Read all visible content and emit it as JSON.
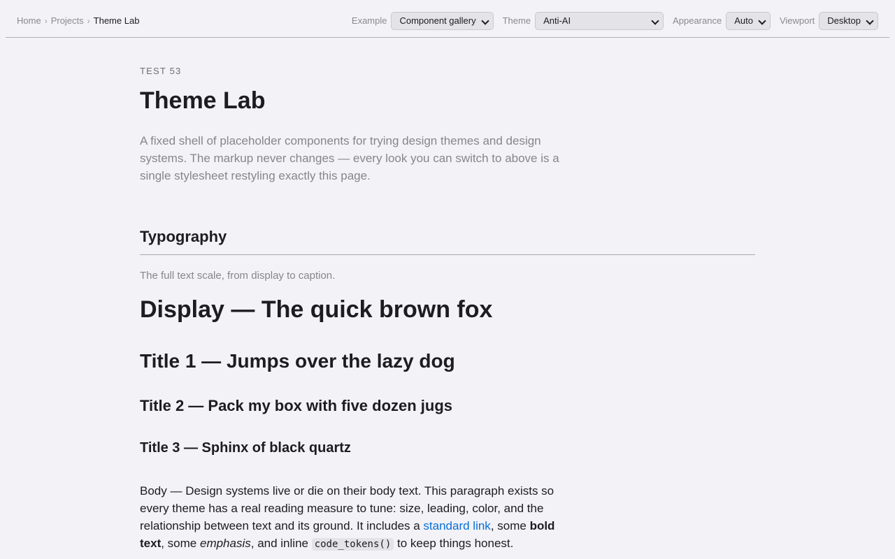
{
  "breadcrumb": {
    "items": [
      "Home",
      "Projects"
    ],
    "separator": "›",
    "current": "Theme Lab"
  },
  "controls": {
    "example": {
      "label": "Example",
      "value": "Component gallery"
    },
    "theme": {
      "label": "Theme",
      "value": "Anti-AI"
    },
    "appearance": {
      "label": "Appearance",
      "value": "Auto"
    },
    "viewport": {
      "label": "Viewport",
      "value": "Desktop"
    }
  },
  "page": {
    "eyebrow": "TEST 53",
    "title": "Theme Lab",
    "lede": "A fixed shell of placeholder components for trying design themes and design systems. The markup never changes — every look you can switch to above is a single stylesheet restyling exactly this page."
  },
  "typography": {
    "heading": "Typography",
    "subtitle": "The full text scale, from display to caption.",
    "display": "Display — The quick brown fox",
    "title1": "Title 1 — Jumps over the lazy dog",
    "title2": "Title 2 — Pack my box with five dozen jugs",
    "title3": "Title 3 — Sphinx of black quartz",
    "body": {
      "part1": "Body — Design systems live or die on their body text. This paragraph exists so every theme has a real reading measure to tune: size, leading, color, and the relationship between text and its ground. It includes a ",
      "link": "standard link",
      "part2": ", some ",
      "bold": "bold text",
      "part3": ", some ",
      "emphasis": "emphasis",
      "part4": ", and inline ",
      "code": "code_tokens()",
      "part5": " to keep things honest."
    }
  },
  "colors": {
    "background": "#f2f2f7",
    "text": "#1d1d1f",
    "muted": "#86868b",
    "link": "#0a6fd6"
  }
}
